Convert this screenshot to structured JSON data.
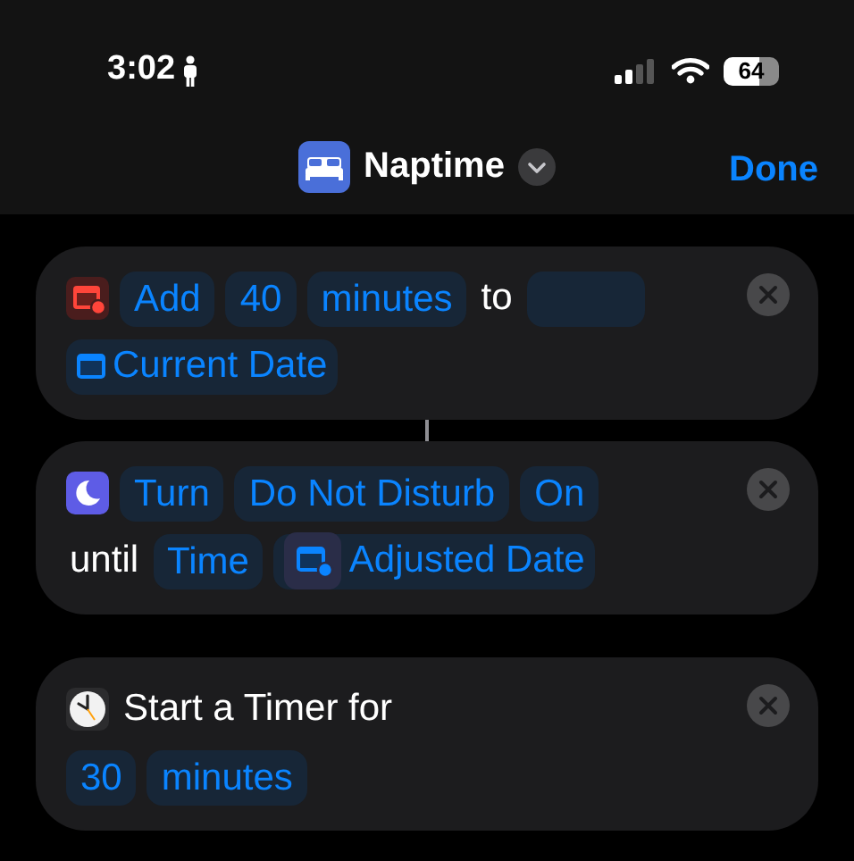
{
  "status_bar": {
    "time": "3:02",
    "battery": "64"
  },
  "nav": {
    "title": "Naptime",
    "done": "Done"
  },
  "actions": [
    {
      "kind": "adjust-date",
      "connected": true,
      "lines": [
        [
          {
            "kind": "param",
            "text": "Add"
          },
          {
            "kind": "param",
            "text": "40"
          },
          {
            "kind": "param",
            "text": "minutes"
          },
          {
            "kind": "text",
            "text": "to"
          },
          {
            "kind": "blank"
          }
        ],
        [
          {
            "kind": "variable",
            "text": "Current Date"
          }
        ]
      ]
    },
    {
      "kind": "focus",
      "connected": false,
      "lines": [
        [
          {
            "kind": "param",
            "text": "Turn"
          },
          {
            "kind": "param",
            "text": "Do Not Disturb"
          },
          {
            "kind": "param",
            "text": "On"
          }
        ],
        [
          {
            "kind": "text",
            "text": "until"
          },
          {
            "kind": "param",
            "text": "Time"
          },
          {
            "kind": "output",
            "text": "Adjusted Date"
          }
        ]
      ]
    },
    {
      "kind": "timer",
      "connected": false,
      "lines": [
        [
          {
            "kind": "text",
            "text": "Start a Timer for"
          }
        ],
        [
          {
            "kind": "param",
            "text": "30"
          },
          {
            "kind": "param",
            "text": "minutes"
          }
        ]
      ]
    }
  ]
}
